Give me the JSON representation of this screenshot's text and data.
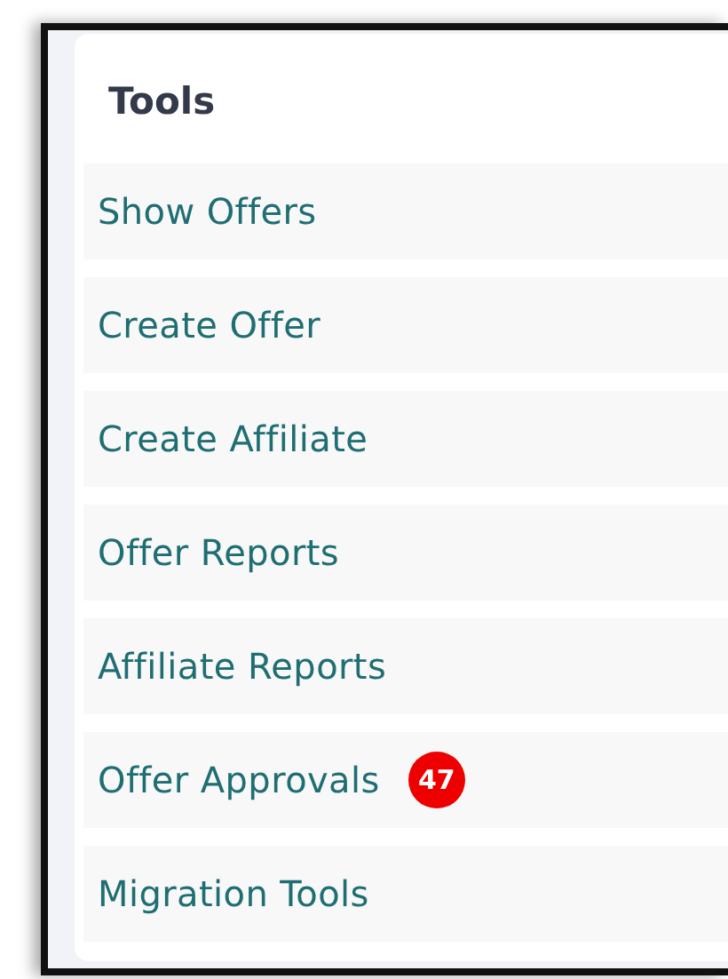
{
  "panel": {
    "title": "Tools",
    "items": [
      {
        "label": "Show Offers"
      },
      {
        "label": "Create Offer"
      },
      {
        "label": "Create Affiliate"
      },
      {
        "label": "Offer Reports"
      },
      {
        "label": "Affiliate Reports"
      },
      {
        "label": "Offer Approvals",
        "badge": "47"
      },
      {
        "label": "Migration Tools"
      }
    ]
  }
}
